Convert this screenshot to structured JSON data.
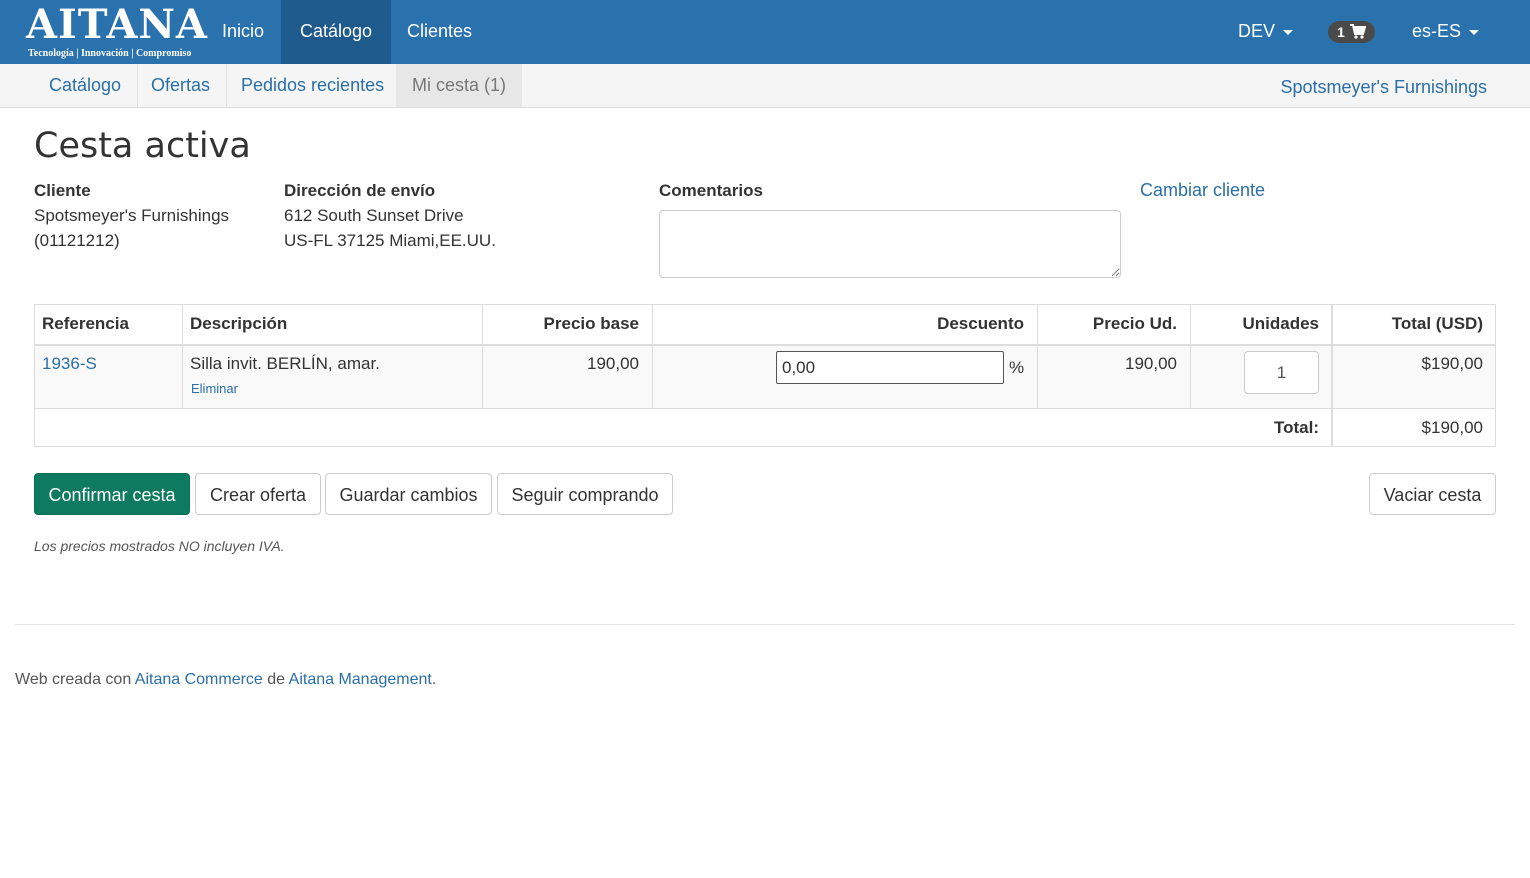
{
  "brand": {
    "logo_text": "AITANA",
    "logo_tagline": "Tecnología | Innovación | Compromiso"
  },
  "topnav": {
    "items": [
      {
        "label": "Inicio"
      },
      {
        "label": "Catálogo"
      },
      {
        "label": "Clientes"
      }
    ],
    "active_index": 1,
    "env": "DEV",
    "cart_count": "1",
    "locale": "es-ES"
  },
  "subnav": {
    "items": [
      {
        "label": "Catálogo"
      },
      {
        "label": "Ofertas"
      },
      {
        "label": "Pedidos recientes"
      },
      {
        "label": "Mi cesta (1)"
      }
    ],
    "active_index": 3,
    "customer": "Spotsmeyer's Furnishings"
  },
  "page": {
    "title": "Cesta activa"
  },
  "info": {
    "client_label": "Cliente",
    "client_name": "Spotsmeyer's Furnishings",
    "client_code": "(01121212)",
    "address_label": "Dirección de envío",
    "address_line1": "612 South Sunset Drive",
    "address_line2": "US-FL 37125 Miami,EE.UU.",
    "comments_label": "Comentarios",
    "comments_value": "",
    "change_client": "Cambiar cliente"
  },
  "table": {
    "headers": {
      "reference": "Referencia",
      "description": "Descripción",
      "base_price": "Precio base",
      "discount": "Descuento",
      "unit_price": "Precio Ud.",
      "units": "Unidades",
      "total": "Total (USD)"
    },
    "rows": [
      {
        "reference": "1936-S",
        "description": "Silla invit. BERLÍN, amar.",
        "remove": "Eliminar",
        "base_price": "190,00",
        "discount": "0,00",
        "discount_unit": "%",
        "unit_price": "190,00",
        "units": "1",
        "total": "$190,00"
      }
    ],
    "total_label": "Total:",
    "total_value": "$190,00"
  },
  "actions": {
    "confirm": "Confirmar cesta",
    "create_offer": "Crear oferta",
    "save": "Guardar cambios",
    "continue": "Seguir comprando",
    "empty": "Vaciar cesta"
  },
  "note": "Los precios mostrados NO incluyen IVA.",
  "footer": {
    "prefix": "Web creada con ",
    "link1": "Aitana Commerce",
    "middle": " de ",
    "link2": "Aitana Management",
    "suffix": "."
  },
  "colors": {
    "navbar": "#2a72ae",
    "navbar_active": "#1f5a8c",
    "link": "#2a6fa8",
    "primary_button": "#0e7a60"
  },
  "icons": [
    "cart-icon",
    "caret-down-icon",
    "resize-grip-icon"
  ]
}
